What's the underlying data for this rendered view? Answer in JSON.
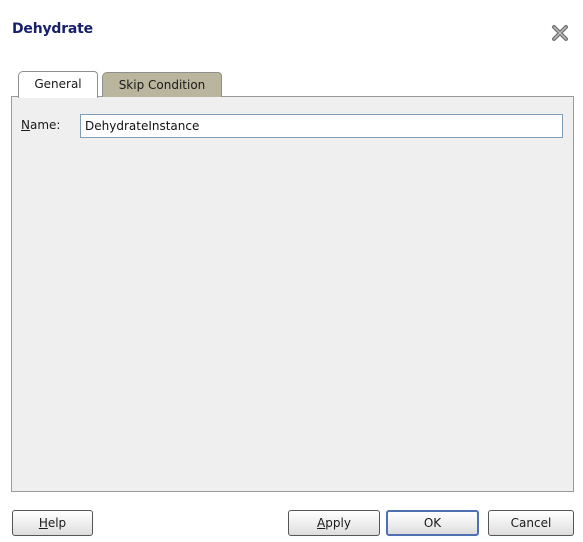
{
  "dialog": {
    "title": "Dehydrate",
    "close_icon": "close-x-icon"
  },
  "tabs": [
    {
      "label": "General",
      "selected": true
    },
    {
      "label": "Skip Condition",
      "selected": false
    }
  ],
  "general_tab": {
    "name_label_mnemonic": "N",
    "name_label_rest": "ame:",
    "name_value": "DehydrateInstance"
  },
  "buttons": {
    "help_mnemonic": "H",
    "help_rest": "elp",
    "apply_mnemonic": "A",
    "apply_rest": "pply",
    "ok_label": "OK",
    "cancel_label": "Cancel"
  },
  "colors": {
    "title": "#17206b",
    "inactive_tab": "#b9b69d",
    "panel_bg": "#efefef",
    "default_button_border": "#4e6fb0"
  }
}
